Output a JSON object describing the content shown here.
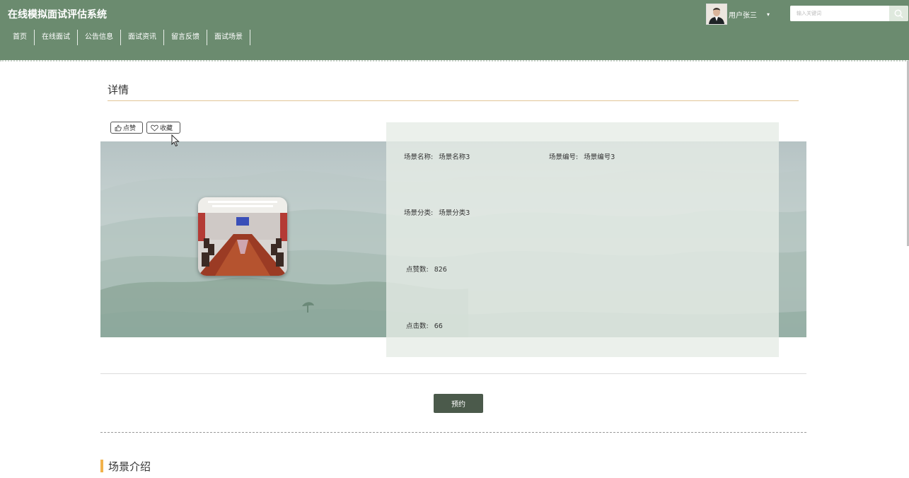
{
  "header": {
    "app_title": "在线模拟面试评估系统",
    "nav": [
      "首页",
      "在线面试",
      "公告信息",
      "面试资讯",
      "留言反馈",
      "面试场景"
    ],
    "user_name": "用户张三",
    "user_caret": "▾",
    "search_placeholder": "输入关键词",
    "search_icon": "search-icon"
  },
  "detail": {
    "title": "详情",
    "like_label": "点赞",
    "favorite_label": "收藏",
    "fields": {
      "name_label": "场景名称:",
      "name_value": "场景名称3",
      "code_label": "场景编号:",
      "code_value": "场景编号3",
      "category_label": "场景分类:",
      "category_value": "场景分类3",
      "likes_label": "点赞数:",
      "likes_value": "826",
      "clicks_label": "点击数:",
      "clicks_value": "66"
    },
    "reserve_label": "预约",
    "intro_heading": "场景介绍"
  },
  "colors": {
    "header_bg": "#6b8b6f",
    "accent_rule": "#e2c697",
    "reserve_button": "#4b5a4b",
    "intro_bar": "#f2b24c"
  }
}
